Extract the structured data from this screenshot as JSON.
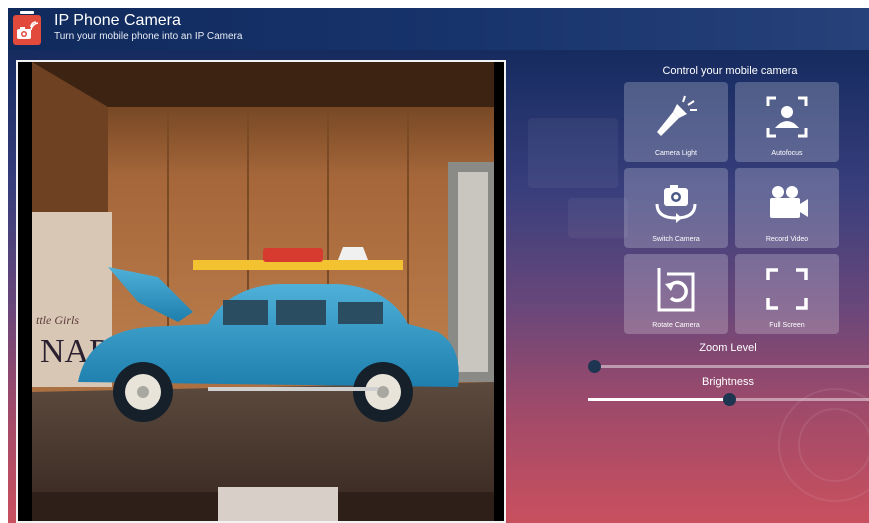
{
  "header": {
    "title": "IP Phone Camera",
    "subtitle": "Turn your mobile phone into an IP Camera"
  },
  "camera_view": {
    "description_icon": "camera-feed"
  },
  "controls": {
    "title": "Control your mobile camera",
    "buttons": [
      {
        "label": "Camera Light",
        "icon": "flashlight-icon"
      },
      {
        "label": "Autofocus",
        "icon": "autofocus-icon"
      },
      {
        "label": "Switch Camera",
        "icon": "switch-camera-icon"
      },
      {
        "label": "Record Video",
        "icon": "record-video-icon"
      },
      {
        "label": "Rotate Camera",
        "icon": "rotate-camera-icon"
      },
      {
        "label": "Full Screen",
        "icon": "full-screen-icon"
      }
    ]
  },
  "zoom": {
    "label": "Zoom Level",
    "value": 0.0
  },
  "brightness": {
    "label": "Brightness",
    "value": 0.5
  },
  "colors": {
    "accent": "#e24a3c",
    "header": "#102a5c",
    "thumb": "#1d3551"
  }
}
